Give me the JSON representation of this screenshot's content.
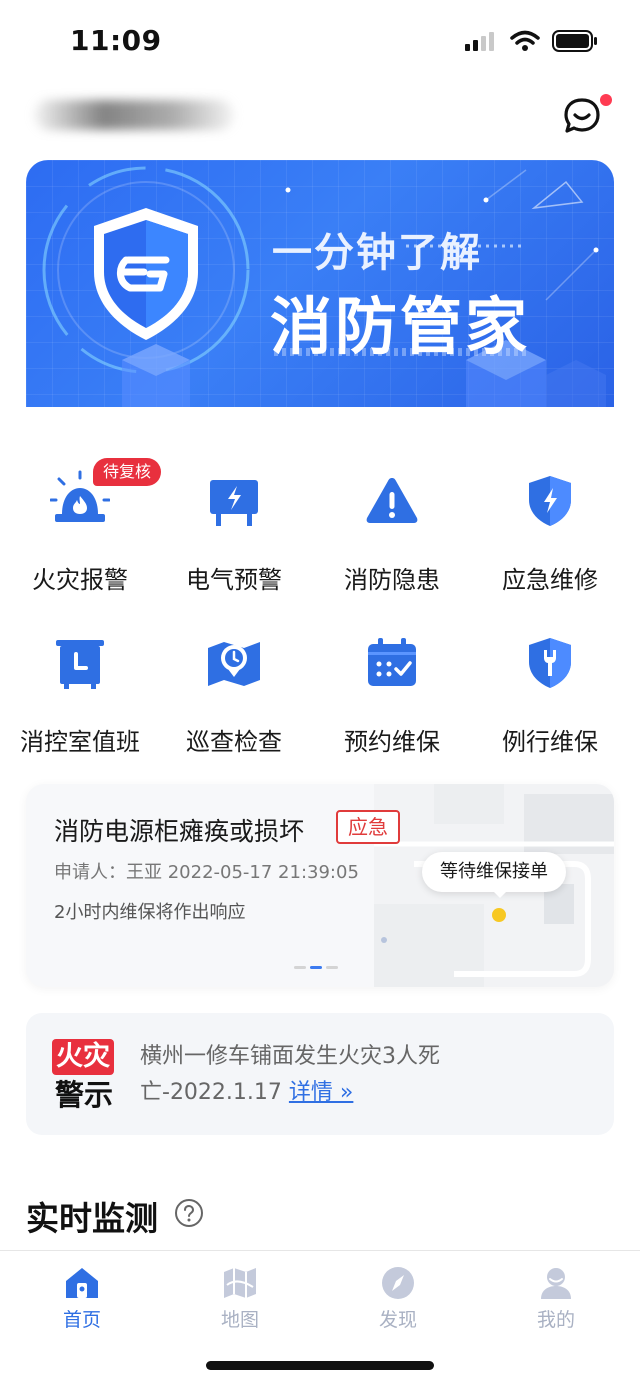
{
  "status": {
    "time": "11:09"
  },
  "header": {
    "message_icon": "chat-smile-icon"
  },
  "banner": {
    "subtitle": "一分钟了解",
    "title": "消防管家"
  },
  "functions": [
    {
      "label": "火灾报警",
      "icon": "alarm-siren-icon",
      "badge": "待复核"
    },
    {
      "label": "电气预警",
      "icon": "electric-panel-icon"
    },
    {
      "label": "消防隐患",
      "icon": "warning-triangle-icon"
    },
    {
      "label": "应急维修",
      "icon": "shield-bolt-icon"
    },
    {
      "label": "消控室值班",
      "icon": "duty-room-icon"
    },
    {
      "label": "巡查检查",
      "icon": "map-clock-icon"
    },
    {
      "label": "预约维保",
      "icon": "calendar-check-icon"
    },
    {
      "label": "例行维保",
      "icon": "shield-wrench-icon"
    }
  ],
  "repair": {
    "title": "消防电源柜瘫痪或损坏",
    "tag": "应急",
    "meta": "申请人：王亚 2022-05-17 21:39:05",
    "note": "2小时内维保将作出响应",
    "map_status": "等待维保接单"
  },
  "alert": {
    "logo_top": "火灾",
    "logo_bottom": "警示",
    "text": "横州一修车铺面发生火灾3人死亡-2022.1.17 ",
    "link": "详情 »"
  },
  "section": {
    "title": "实时监测"
  },
  "tabs": [
    {
      "label": "首页",
      "icon": "home-icon",
      "active": true
    },
    {
      "label": "地图",
      "icon": "map-icon",
      "active": false
    },
    {
      "label": "发现",
      "icon": "compass-icon",
      "active": false
    },
    {
      "label": "我的",
      "icon": "profile-icon",
      "active": false
    }
  ],
  "colors": {
    "primary": "#2f6fe3",
    "danger": "#e8303e",
    "banner": "#3a7ff6"
  }
}
